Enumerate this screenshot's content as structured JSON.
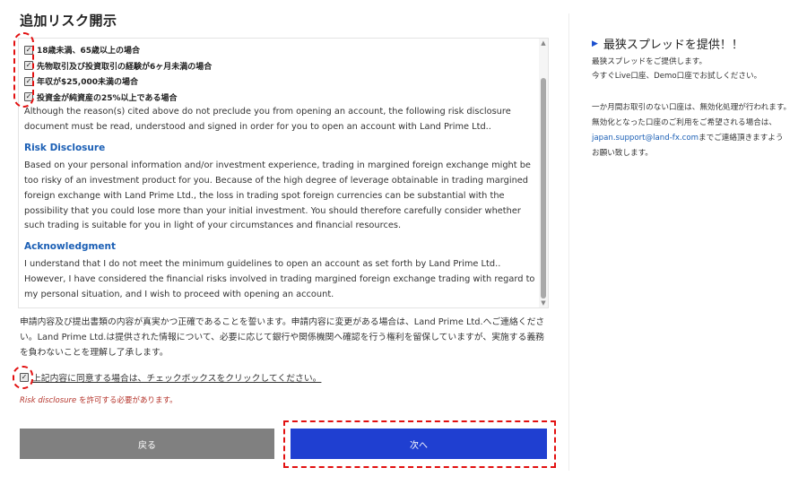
{
  "page_title": "追加リスク開示",
  "checklist": [
    {
      "label": "18歳未満、65歳以上の場合",
      "checked": true
    },
    {
      "label": "先物取引及び投資取引の経験が6ヶ月未満の場合",
      "checked": true
    },
    {
      "label": "年収が$25,000未満の場合",
      "checked": true
    },
    {
      "label": "投資金が純資産の25%以上である場合",
      "checked": true
    }
  ],
  "content": {
    "intro": "Although the reason(s) cited above do not preclude you from opening an account, the following risk disclosure document must be read, understood and signed in order for you to open an account with Land Prime Ltd..",
    "risk_heading": "Risk Disclosure",
    "risk_body": "Based on your personal information and/or investment experience, trading in margined foreign exchange might be too risky of an investment product for you. Because of the high degree of leverage obtainable in trading margined foreign exchange with Land Prime Ltd., the loss in trading spot foreign currencies can be substantial with the possibility that you could lose more than your initial investment. You should therefore carefully consider whether such trading is suitable for you in light of your circumstances and financial resources.",
    "ack_heading": "Acknowledgment",
    "ack_body": "I understand that I do not meet the minimum guidelines to open an account as set forth by Land Prime Ltd.. However, I have considered the financial risks involved in trading margined foreign exchange trading with regard to my personal situation, and I wish to proceed with opening an account."
  },
  "declaration": "申請内容及び提出書類の内容が真実かつ正確であることを誓います。申請内容に変更がある場合は、Land Prime Ltd.へご連絡ください。Land Prime Ltd.は提供された情報について、必要に応じて銀行や関係機関へ確認を行う権利を留保していますが、実施する義務を負わないことを理解し了承します。",
  "agree": {
    "label": "上記内容に同意する場合は、チェックボックスをクリックしてください。",
    "checked": true
  },
  "error": {
    "em": "Risk disclosure",
    "text": " を許可する必要があります。"
  },
  "buttons": {
    "back": "戻る",
    "next": "次へ"
  },
  "sidebar": {
    "heading": "最狭スプレッドを提供！！",
    "line1": "最狭スプレッドをご提供します。",
    "line2": "今すぐLive口座、Demo口座でお試しください。",
    "line3": "一か月間お取引のない口座は、無効化処理が行われます。",
    "line4": "無効化となった口座のご利用をご希望される場合は、",
    "email": "japan.support@land-fx.com",
    "line5_suffix": "までご連絡頂きますよう",
    "line6": "お願い致します。"
  },
  "colors": {
    "accent": "#1f3fd1",
    "back_button": "#808080",
    "heading_link": "#1b5fb5",
    "error": "#b5342b",
    "annotation": "#e21010"
  }
}
